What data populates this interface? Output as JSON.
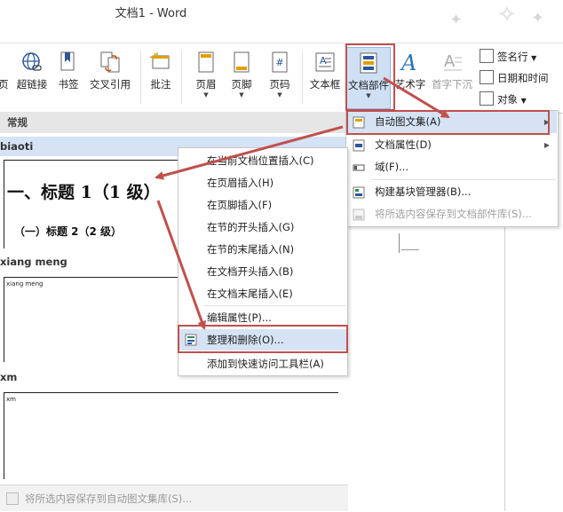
{
  "window": {
    "title": "文档1 - Word"
  },
  "ribbon": {
    "partial_label": "页",
    "buttons": [
      {
        "id": "hyperlink",
        "label": "超链接",
        "icon": "globe-link-icon"
      },
      {
        "id": "bookmark",
        "label": "书签",
        "icon": "bookmark-flag-icon"
      },
      {
        "id": "crossref",
        "label": "交叉引用",
        "icon": "cross-reference-icon"
      },
      {
        "id": "comment",
        "label": "批注",
        "icon": "comment-icon"
      },
      {
        "id": "header",
        "label": "页眉",
        "icon": "header-icon"
      },
      {
        "id": "footer",
        "label": "页脚",
        "icon": "footer-icon"
      },
      {
        "id": "pagenum",
        "label": "页码",
        "icon": "page-number-icon"
      },
      {
        "id": "textbox",
        "label": "文本框",
        "icon": "textbox-icon"
      },
      {
        "id": "quickparts",
        "label": "文档部件",
        "icon": "quick-parts-icon"
      },
      {
        "id": "wordart",
        "label": "艺术字",
        "icon": "wordart-icon"
      },
      {
        "id": "dropcap",
        "label": "首字下沉",
        "icon": "drop-cap-icon"
      }
    ],
    "small_buttons": [
      {
        "label": "签名行",
        "icon": "signature-line-icon"
      },
      {
        "label": "日期和时间",
        "icon": "calendar-icon"
      },
      {
        "label": "对象",
        "icon": "object-icon"
      }
    ]
  },
  "gallery": {
    "header": "常规",
    "items": [
      {
        "name": "biaoti",
        "preview_h1": "一、标题 1（1 级）",
        "preview_h2": "（一）标题 2（2 级）"
      },
      {
        "name": "xiang meng",
        "preview_text": "xiang meng"
      },
      {
        "name": "xm",
        "preview_text": "xm"
      }
    ],
    "footer": "将所选内容保存到自动图文集库(S)..."
  },
  "submenu": {
    "items": [
      {
        "label": "在当前文档位置插入(C)"
      },
      {
        "label": "在页眉插入(H)"
      },
      {
        "label": "在页脚插入(F)"
      },
      {
        "label": "在节的开头插入(G)"
      },
      {
        "label": "在节的末尾插入(N)"
      },
      {
        "label": "在文档开头插入(B)"
      },
      {
        "label": "在文档末尾插入(E)"
      },
      {
        "label": "编辑属性(P)..."
      },
      {
        "label": "整理和删除(O)...",
        "icon": "organize-delete-icon"
      },
      {
        "label": "添加到快速访问工具栏(A)"
      }
    ]
  },
  "dropdown": {
    "items": [
      {
        "label": "自动图文集(A)",
        "icon": "autotext-icon"
      },
      {
        "label": "文档属性(D)",
        "icon": "document-property-icon"
      },
      {
        "label": "域(F)...",
        "icon": "field-icon"
      },
      {
        "label": "构建基块管理器(B)...",
        "icon": "building-blocks-icon"
      },
      {
        "label": "将所选内容保存到文档部件库(S)...",
        "icon": "save-to-gallery-icon"
      }
    ]
  },
  "colors": {
    "highlight": "#d5e3f4",
    "annotation_red": "#c0504d",
    "accent_blue": "#2b579a"
  }
}
